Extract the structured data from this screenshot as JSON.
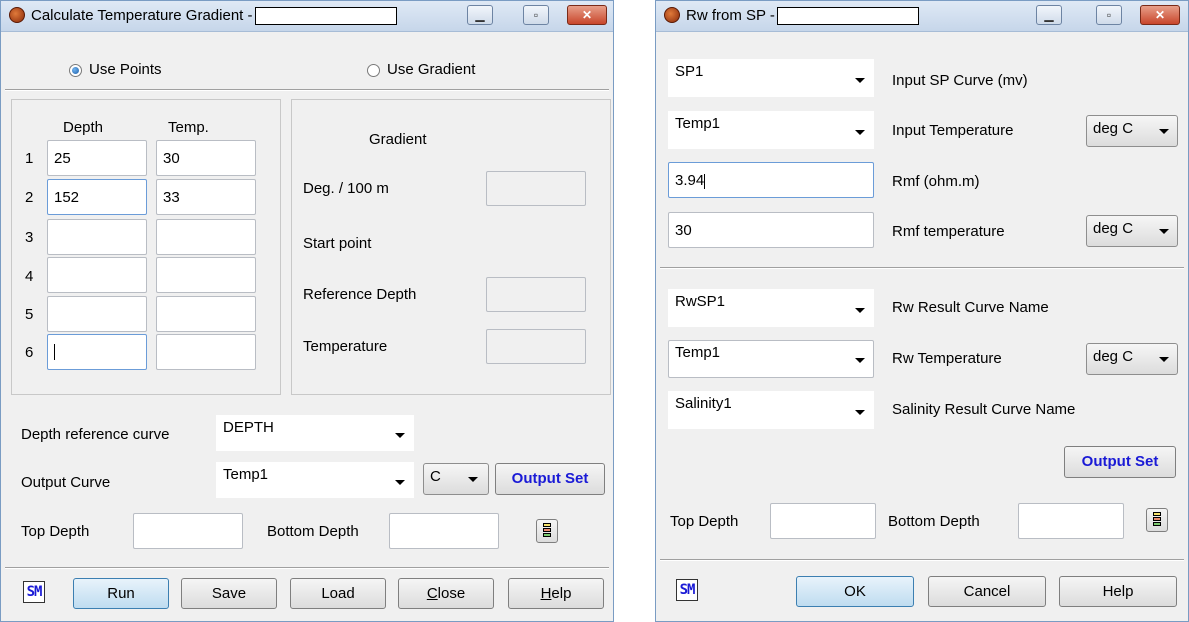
{
  "left": {
    "title": "Calculate Temperature Gradient -",
    "radio_points": "Use Points",
    "radio_gradient": "Use Gradient",
    "col_depth": "Depth",
    "col_temp": "Temp.",
    "rows": [
      {
        "num": "1",
        "depth": "25",
        "temp": "30"
      },
      {
        "num": "2",
        "depth": "152",
        "temp": "33"
      },
      {
        "num": "3",
        "depth": "",
        "temp": ""
      },
      {
        "num": "4",
        "depth": "",
        "temp": ""
      },
      {
        "num": "5",
        "depth": "",
        "temp": ""
      },
      {
        "num": "6",
        "depth": "",
        "temp": ""
      }
    ],
    "gradient_title": "Gradient",
    "deg_label": "Deg. / 100 m",
    "start_point": "Start point",
    "ref_depth": "Reference Depth",
    "temperature": "Temperature",
    "depth_ref_curve_label": "Depth reference curve",
    "depth_ref_curve_value": "DEPTH",
    "output_curve_label": "Output Curve",
    "output_curve_value": "Temp1",
    "unit_value": "C",
    "output_set": "Output Set",
    "top_depth": "Top Depth",
    "bottom_depth": "Bottom Depth",
    "sm": "SM",
    "run": "Run",
    "save": "Save",
    "load": "Load",
    "close_c": "C",
    "close_rest": "lose",
    "help_h": "H",
    "help_rest": "elp"
  },
  "right": {
    "title": "Rw from SP -",
    "sp_value": "SP1",
    "sp_label": "Input SP Curve (mv)",
    "temp_value": "Temp1",
    "temp_label": "Input Temperature",
    "temp_unit": "deg C",
    "rmf_value": "3.94",
    "rmf_label": "Rmf (ohm.m)",
    "rmft_value": "30",
    "rmft_label": "Rmf temperature",
    "rmft_unit": "deg C",
    "rw_value": "RwSP1",
    "rw_label": "Rw Result Curve Name",
    "rwt_value": "Temp1",
    "rwt_label": "Rw Temperature",
    "rwt_unit": "deg C",
    "sal_value": "Salinity1",
    "sal_label": "Salinity Result Curve Name",
    "output_set": "Output Set",
    "top_depth": "Top Depth",
    "bottom_depth": "Bottom Depth",
    "sm": "SM",
    "ok": "OK",
    "cancel": "Cancel",
    "help": "Help"
  }
}
